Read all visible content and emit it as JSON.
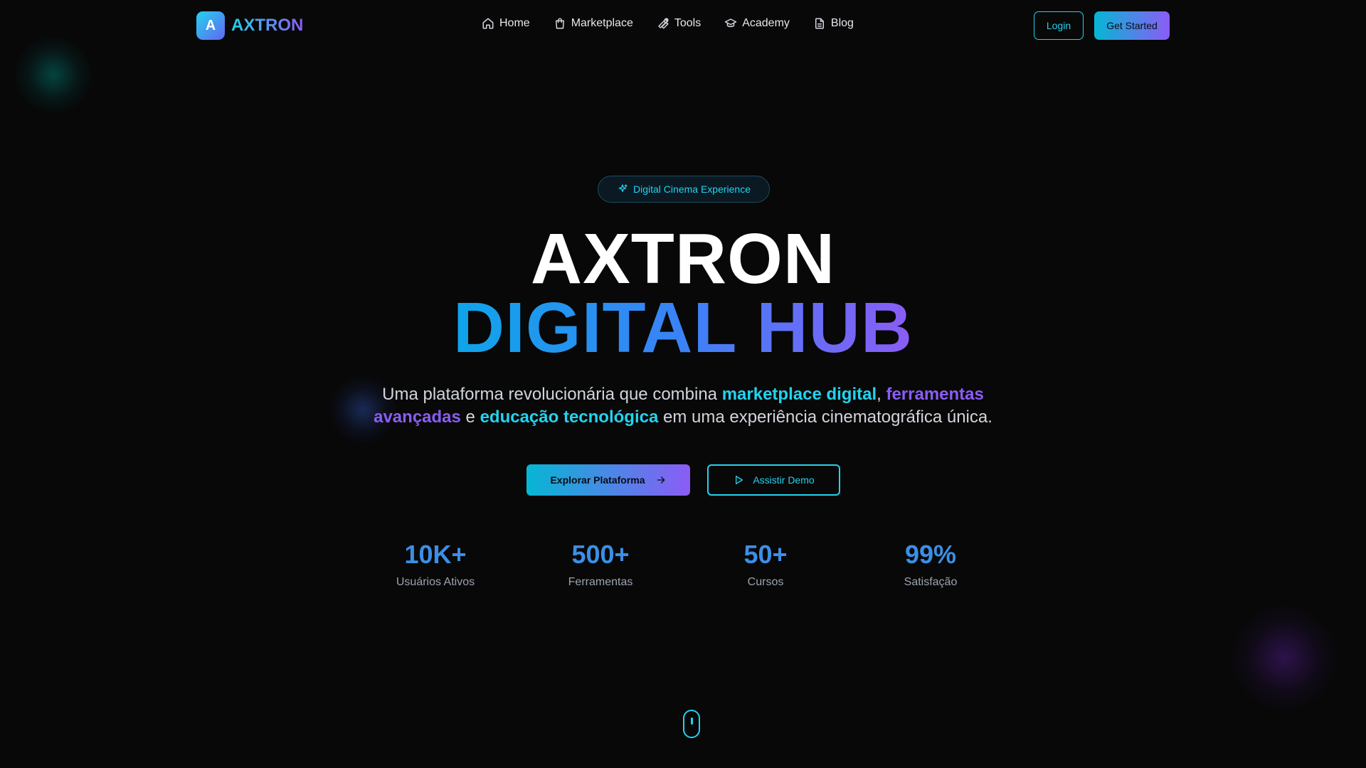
{
  "brand": {
    "logo_letter": "A",
    "name": "AXTRON"
  },
  "nav": {
    "items": [
      {
        "label": "Home",
        "icon": "home-icon"
      },
      {
        "label": "Marketplace",
        "icon": "shopping-bag-icon"
      },
      {
        "label": "Tools",
        "icon": "wrench-icon"
      },
      {
        "label": "Academy",
        "icon": "graduation-cap-icon"
      },
      {
        "label": "Blog",
        "icon": "document-icon"
      }
    ],
    "login_label": "Login",
    "get_started_label": "Get Started"
  },
  "hero": {
    "badge": "Digital Cinema Experience",
    "title": "AXTRON",
    "subtitle": "DIGITAL HUB",
    "description": {
      "part1": "Uma plataforma revolucionária que combina ",
      "hl1": "marketplace digital",
      "part2": ", ",
      "hl2": "ferramentas avançadas",
      "part3": " e ",
      "hl3": "educação tecnológica",
      "part4": " em uma experiência cinematográfica única."
    },
    "primary_cta": "Explorar Plataforma",
    "secondary_cta": "Assistir Demo"
  },
  "stats": [
    {
      "value": "10K+",
      "label": "Usuários Ativos"
    },
    {
      "value": "500+",
      "label": "Ferramentas"
    },
    {
      "value": "50+",
      "label": "Cursos"
    },
    {
      "value": "99%",
      "label": "Satisfação"
    }
  ],
  "colors": {
    "background": "#080808",
    "accent_cyan": "#22d3ee",
    "accent_purple": "#8b5cf6",
    "stat_blue": "#3b8fe6"
  }
}
